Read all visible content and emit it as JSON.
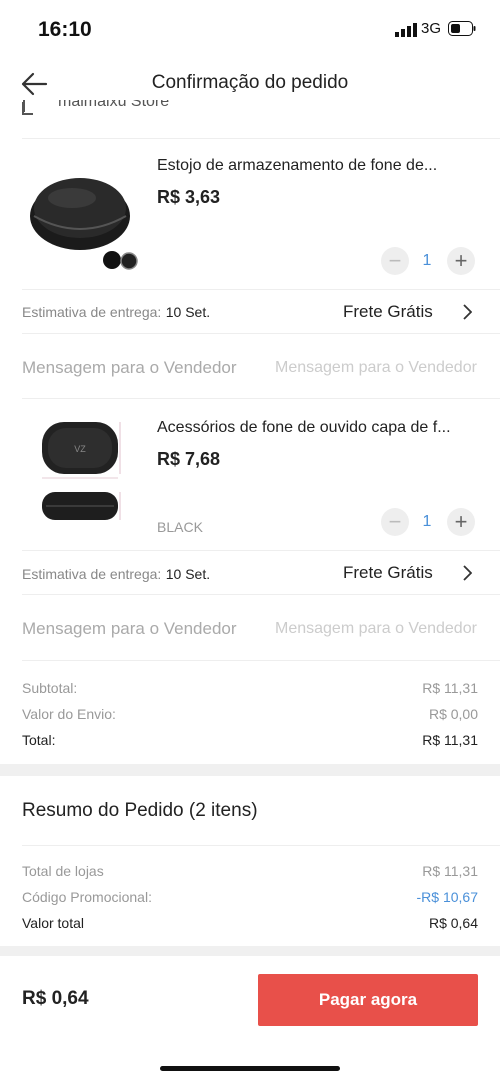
{
  "status": {
    "time": "16:10",
    "network": "3G"
  },
  "header": {
    "title": "Confirmação do pedido"
  },
  "store": {
    "name": "maimaixu Store"
  },
  "items": [
    {
      "name": "Estojo de armazenamento de fone de...",
      "price": "R$ 3,63",
      "variant": "",
      "quantity": "1",
      "delivery_label": "Estimativa de entrega:",
      "delivery_date": "10 Set.",
      "shipping": "Frete Grátis",
      "message_label": "Mensagem para o Vendedor",
      "message_placeholder": "Mensagem para o Vendedor"
    },
    {
      "name": "Acessórios de fone de ouvido capa de f...",
      "price": "R$ 7,68",
      "variant": "BLACK",
      "quantity": "1",
      "delivery_label": "Estimativa de entrega:",
      "delivery_date": "10 Set.",
      "shipping": "Frete Grátis",
      "message_label": "Mensagem para o Vendedor",
      "message_placeholder": "Mensagem para o Vendedor"
    }
  ],
  "store_summary": {
    "subtotal_label": "Subtotal:",
    "subtotal_value": "R$ 11,31",
    "shipping_label": "Valor do Envio:",
    "shipping_value": "R$ 0,00",
    "total_label": "Total:",
    "total_value": "R$ 11,31"
  },
  "order_summary": {
    "title": "Resumo do Pedido (2 itens)",
    "stores_total_label": "Total de lojas",
    "stores_total_value": "R$ 11,31",
    "promo_label": "Código Promocional:",
    "promo_value": "-R$ 10,67",
    "grand_total_label": "Valor total",
    "grand_total_value": "R$ 0,64"
  },
  "footer": {
    "price": "R$ 0,64",
    "pay_label": "Pagar agora"
  },
  "colors": {
    "accent": "#e8504a",
    "link": "#4a90d9"
  }
}
